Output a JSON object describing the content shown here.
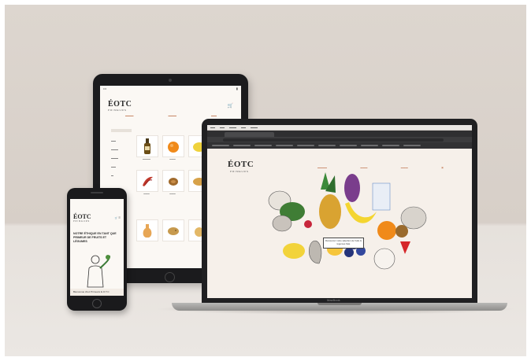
{
  "tablet": {
    "logo": "ÉOTC",
    "logo_sub": "PRIMEURS"
  },
  "phone": {
    "logo": "ÉOTC",
    "logo_sub": "PRIMEURS",
    "headline": "NOTRE ÉTHIQUE EN TANT QUE PRIMEUR DE FRUITS ET LÉGUMES",
    "footer": "Bienvenue chez Primeurs E.O.T.C"
  },
  "laptop": {
    "logo": "ÉOTC",
    "logo_sub": "PRIMEURS",
    "cta": "Découvrez notre sélection de fruits & légumes frais",
    "brand": "MacBook"
  }
}
